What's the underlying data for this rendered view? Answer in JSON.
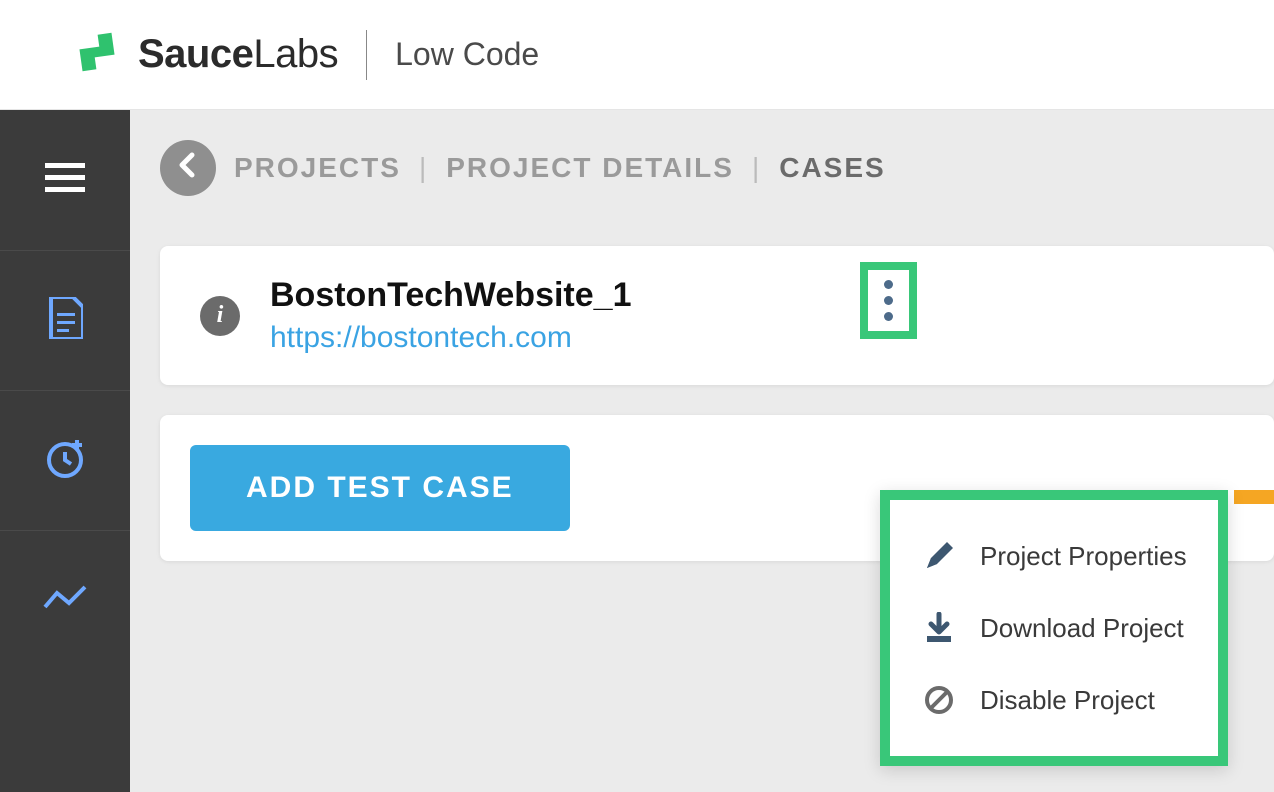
{
  "header": {
    "brand_bold": "Sauce",
    "brand_rest": "Labs",
    "sub": "Low Code"
  },
  "breadcrumb": {
    "items": [
      "PROJECTS",
      "PROJECT DETAILS",
      "CASES"
    ]
  },
  "project": {
    "name": "BostonTechWebsite_1",
    "url": "https://bostontech.com"
  },
  "menu": {
    "properties": "Project Properties",
    "download": "Download Project",
    "disable": "Disable Project"
  },
  "buttons": {
    "add_test_case": "ADD TEST CASE"
  }
}
